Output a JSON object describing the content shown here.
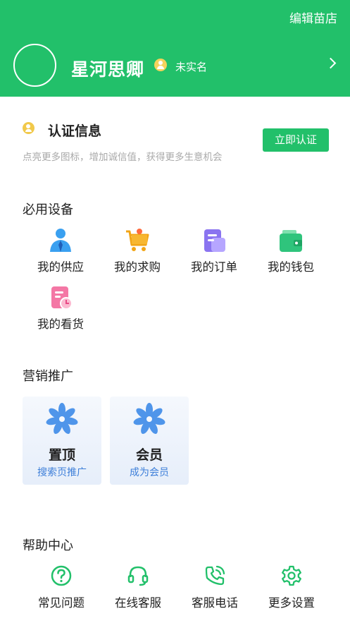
{
  "header": {
    "edit_shop": "编辑苗店",
    "username": "星河思卿",
    "verify_status": "未实名",
    "bg_color": "#22c06a"
  },
  "certification": {
    "title": "认证信息",
    "subtitle": "点亮更多图标，增加诚信值，获得更多生意机会",
    "button": "立即认证"
  },
  "tools": {
    "title": "必用设备",
    "items": [
      {
        "label": "我的供应",
        "icon": "supply-person-icon"
      },
      {
        "label": "我的求购",
        "icon": "shopping-cart-icon"
      },
      {
        "label": "我的订单",
        "icon": "order-document-icon"
      },
      {
        "label": "我的钱包",
        "icon": "wallet-icon"
      },
      {
        "label": "我的看货",
        "icon": "inspection-clock-icon"
      }
    ]
  },
  "marketing": {
    "title": "营销推广",
    "cards": [
      {
        "title": "置顶",
        "subtitle": "搜索页推广",
        "icon": "flower-icon"
      },
      {
        "title": "会员",
        "subtitle": "成为会员",
        "icon": "flower-icon"
      }
    ]
  },
  "help": {
    "title": "帮助中心",
    "items": [
      {
        "label": "常见问题",
        "icon": "question-icon"
      },
      {
        "label": "在线客服",
        "icon": "headset-icon"
      },
      {
        "label": "客服电话",
        "icon": "phone-icon"
      },
      {
        "label": "更多设置",
        "icon": "gear-icon"
      }
    ]
  }
}
